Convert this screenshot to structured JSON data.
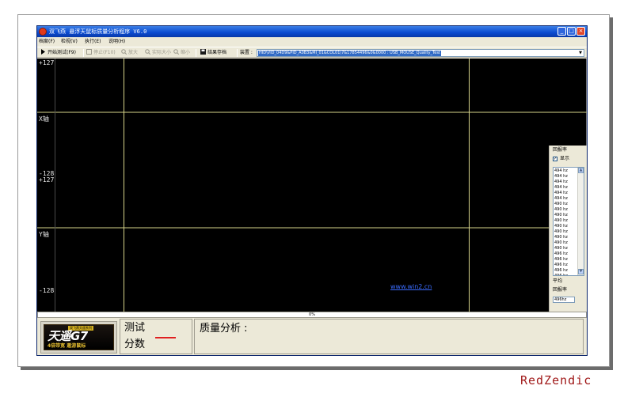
{
  "window": {
    "title": "双飞燕 悬浮天鼠标质量分析程序 V6.0",
    "controls": [
      "minimize-icon",
      "maximize-icon",
      "close-icon"
    ]
  },
  "menu": {
    "items": [
      {
        "label": "档案(F)"
      },
      {
        "label": "检视(V)"
      },
      {
        "label": "执行(E)"
      },
      {
        "label": "说明(H)"
      }
    ]
  },
  "toolbar": {
    "start_test": "开始测试(F9)",
    "stop_test": "停止(F10)",
    "zoom_in": "放大",
    "actual_size": "实际大小",
    "zoom_out": "缩小",
    "save_result": "结果存档",
    "device_label": "装置 :",
    "device_value": "HID\\VID_04D9&PID_A0B3&MI_01&COL01\\7&17854496&0&0000 : USB_MOUSE_Quality_Test"
  },
  "plot": {
    "x_axis": {
      "max": "+127",
      "name": "X轴",
      "min": "-128"
    },
    "y_axis": {
      "max": "+127",
      "name": "Y轴",
      "min": "-128"
    },
    "watermark_link": "www.win2.cn",
    "background": "#000000",
    "line_color": "#d6d38a"
  },
  "side_panel": {
    "title": "回报率",
    "show_label": "显示",
    "show_checked": true,
    "rates": [
      "494 hz",
      "494 hz",
      "494 hz",
      "494 hz",
      "494 hz",
      "494 hz",
      "490 hz",
      "490 hz",
      "490 hz",
      "490 hz",
      "490 hz",
      "490 hz",
      "490 hz",
      "490 hz",
      "490 hz",
      "496 hz",
      "496 hz",
      "496 hz",
      "496 hz",
      "496 hz"
    ],
    "average_label": "平均",
    "average_rate_label": "回报率",
    "average_value": "496hz"
  },
  "progress": {
    "text": "0%",
    "value": 0
  },
  "bottom": {
    "logo": {
      "tag": "双飞燕天遥系列",
      "main": "天遥G7",
      "sub": "4倍带宽 遨游鼠标"
    },
    "score_label_1": "测试",
    "score_label_2": "分数",
    "analysis_label": "质量分析 :"
  },
  "overlay_watermark": "RedZendic",
  "colors": {
    "titlebar": "#0a4ad0",
    "accent_red": "#e02020",
    "selection": "#316ac5"
  }
}
